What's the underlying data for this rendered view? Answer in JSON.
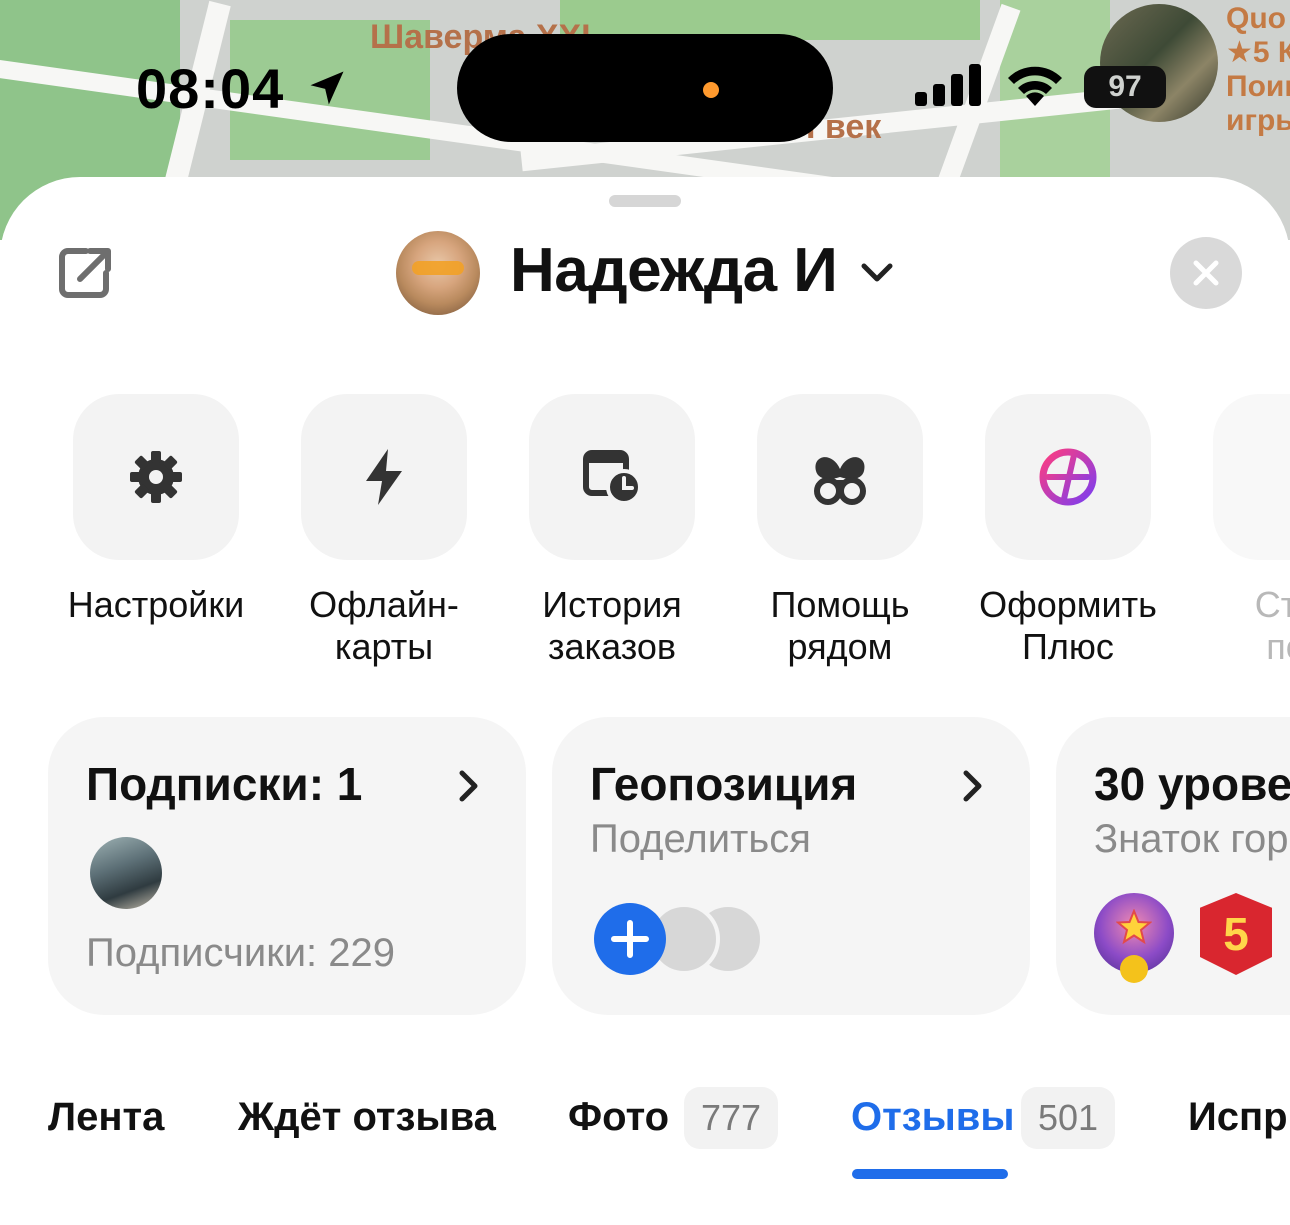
{
  "status_bar": {
    "time": "08:04",
    "battery": "97"
  },
  "map": {
    "label_shaverma": "Шаверма XXI",
    "label_vek": "I век",
    "right_snippet": [
      "Quo",
      "★5 К",
      "Поиг",
      "игры"
    ]
  },
  "header": {
    "user_name": "Надежда И"
  },
  "actions": [
    {
      "label": "Настройки",
      "icon": "gear-icon"
    },
    {
      "label": "Офлайн-\nкарты",
      "icon": "lightning-icon"
    },
    {
      "label": "История\nзаказов",
      "icon": "order-history-icon"
    },
    {
      "label": "Помощь\nрядом",
      "icon": "help-nearby-icon"
    },
    {
      "label": "Оформить\nПлюс",
      "icon": "plus-subscription-icon"
    },
    {
      "label": "Стра\nпое",
      "icon": "partial-icon"
    }
  ],
  "cards": {
    "subscriptions": {
      "title": "Подписки: 1",
      "followers": "Подписчики: 229"
    },
    "geo": {
      "title": "Геопозиция",
      "subtitle": "Поделиться"
    },
    "level": {
      "title": "30 урове",
      "subtitle": "Знаток гор",
      "badge_number": "5"
    }
  },
  "tabs": [
    {
      "label": "Лента"
    },
    {
      "label": "Ждёт отзыва"
    },
    {
      "label": "Фото",
      "count": "777"
    },
    {
      "label": "Отзывы",
      "count": "501",
      "active": true
    },
    {
      "label": "Испр"
    }
  ],
  "colors": {
    "accent": "#1f6dea",
    "plus_gradient_start": "#ff3d7f",
    "plus_gradient_end": "#7b3df0"
  }
}
